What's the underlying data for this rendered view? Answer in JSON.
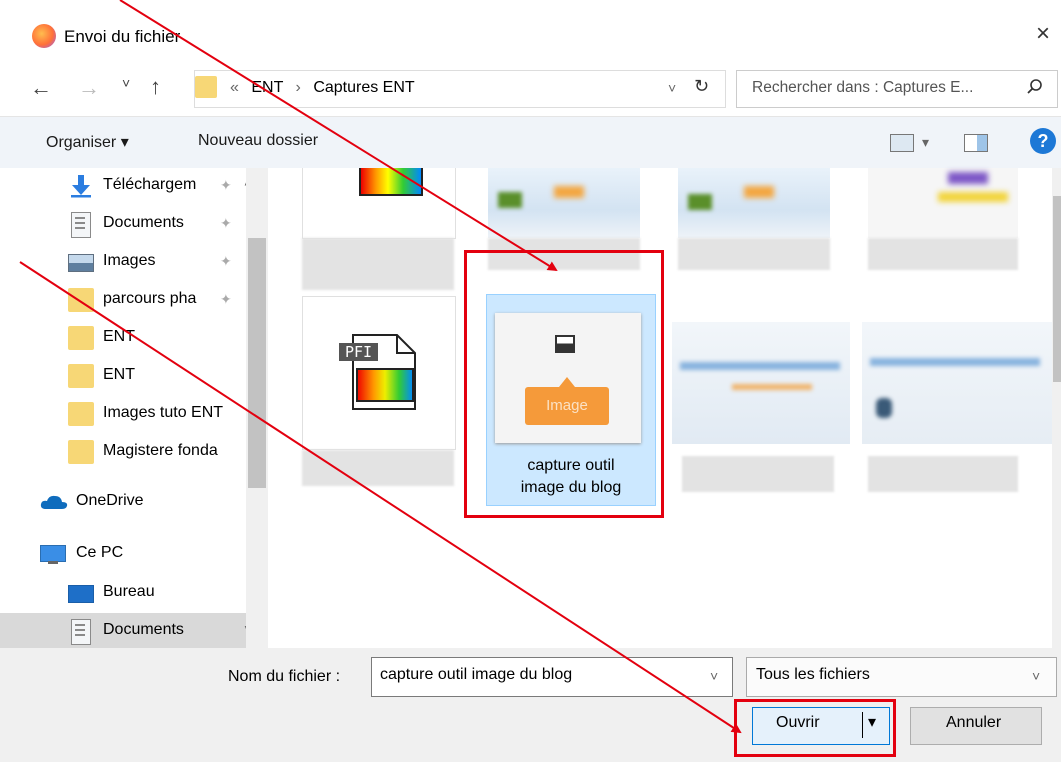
{
  "window": {
    "title": "Envoi du fichier",
    "close_glyph": "×"
  },
  "nav": {
    "back": "←",
    "forward": "→",
    "dropdown": "˅",
    "up": "↑",
    "breadcrumb": [
      "«",
      "ENT",
      "›",
      "Captures ENT"
    ],
    "refresh": "↻",
    "search_placeholder": "Rechercher dans : Captures E...",
    "search_icon": "search-icon"
  },
  "toolbar": {
    "organize": "Organiser ▾",
    "new_folder": "Nouveau dossier",
    "help": "?"
  },
  "sidebar": {
    "items": [
      {
        "label": "Téléchargem",
        "icon": "download-icon",
        "pinned": true
      },
      {
        "label": "Documents",
        "icon": "documents-icon",
        "pinned": true
      },
      {
        "label": "Images",
        "icon": "images-icon",
        "pinned": true
      },
      {
        "label": "parcours pha",
        "icon": "folder-icon",
        "pinned": true
      },
      {
        "label": "ENT",
        "icon": "folder-icon",
        "pinned": false
      },
      {
        "label": "ENT",
        "icon": "folder-icon",
        "pinned": false
      },
      {
        "label": "Images tuto ENT",
        "icon": "folder-icon",
        "pinned": false
      },
      {
        "label": "Magistere fonda",
        "icon": "folder-icon",
        "pinned": false
      },
      {
        "label": "OneDrive",
        "icon": "cloud-icon",
        "pinned": false
      },
      {
        "label": "Ce PC",
        "icon": "computer-icon",
        "pinned": false
      },
      {
        "label": "Bureau",
        "icon": "desktop-icon",
        "pinned": false
      },
      {
        "label": "Documents",
        "icon": "documents-icon",
        "pinned": false
      }
    ]
  },
  "files": {
    "selected_name_line1": "capture outil",
    "selected_name_line2": "image du blog",
    "selected_thumb_badge": "Image",
    "pfi_badge": "PFI"
  },
  "footer": {
    "filename_label": "Nom du fichier :",
    "filename_value": "capture outil image du blog",
    "filetype_value": "Tous les fichiers",
    "open_label": "Ouvrir",
    "cancel_label": "Annuler"
  },
  "colors": {
    "highlight_red": "#e3000f",
    "selection_blue": "#cce8ff",
    "accent": "#0078d7"
  }
}
